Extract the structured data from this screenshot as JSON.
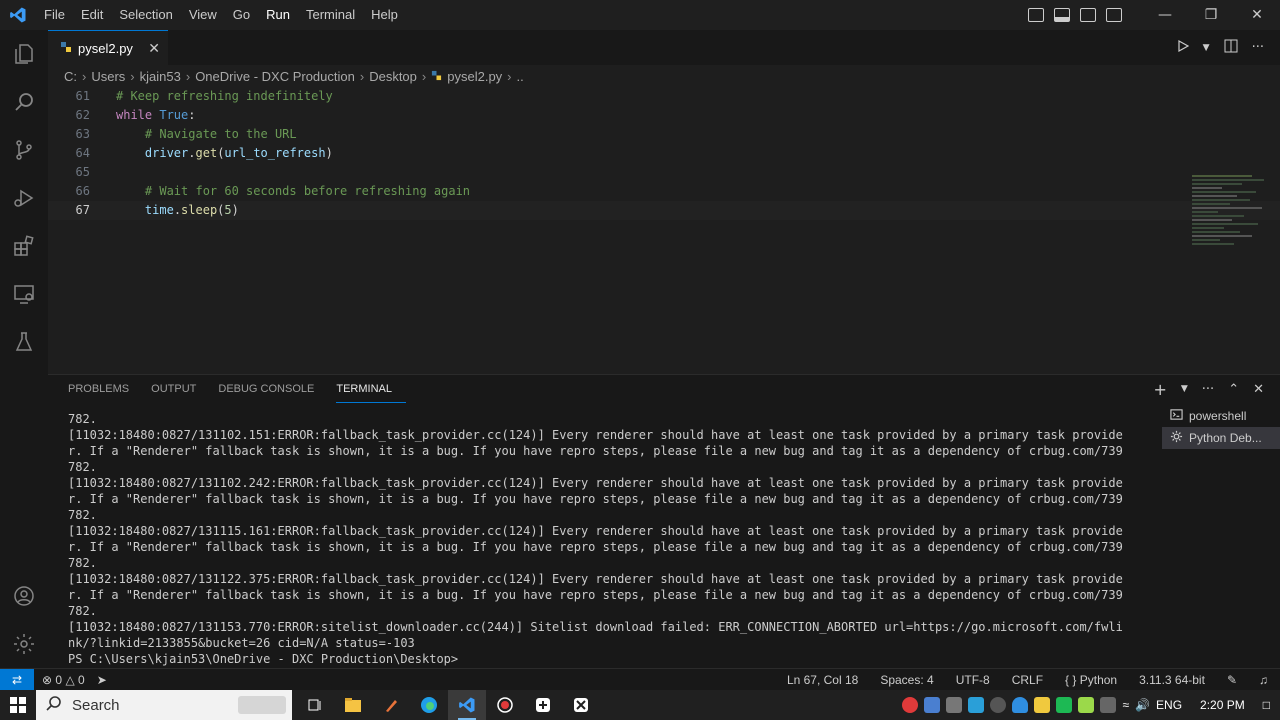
{
  "menu": [
    "File",
    "Edit",
    "Selection",
    "View",
    "Go",
    "Run",
    "Terminal",
    "Help"
  ],
  "menu_active_index": 5,
  "tab": {
    "filename": "pysel2.py",
    "close": "✕"
  },
  "breadcrumb": [
    "C:",
    "Users",
    "kjain53",
    "OneDrive - DXC Production",
    "Desktop",
    "pysel2.py",
    ".."
  ],
  "code": {
    "current_line": 67,
    "lines": [
      {
        "num": "61",
        "indent": "",
        "tokens": [
          {
            "t": "# Keep refreshing indefinitely",
            "c": "cmt"
          }
        ]
      },
      {
        "num": "62",
        "indent": "",
        "tokens": [
          {
            "t": "while",
            "c": "kw"
          },
          {
            "t": " ",
            "c": "plain"
          },
          {
            "t": "True",
            "c": "const"
          },
          {
            "t": ":",
            "c": "plain"
          }
        ]
      },
      {
        "num": "63",
        "indent": "    ",
        "tokens": [
          {
            "t": "# Navigate to the URL",
            "c": "cmt"
          }
        ]
      },
      {
        "num": "64",
        "indent": "    ",
        "tokens": [
          {
            "t": "driver",
            "c": "var"
          },
          {
            "t": ".",
            "c": "plain"
          },
          {
            "t": "get",
            "c": "fn"
          },
          {
            "t": "(",
            "c": "plain"
          },
          {
            "t": "url_to_refresh",
            "c": "var"
          },
          {
            "t": ")",
            "c": "plain"
          }
        ]
      },
      {
        "num": "65",
        "indent": "",
        "tokens": []
      },
      {
        "num": "66",
        "indent": "    ",
        "tokens": [
          {
            "t": "# Wait for 60 seconds before refreshing again",
            "c": "cmt"
          }
        ]
      },
      {
        "num": "67",
        "indent": "    ",
        "tokens": [
          {
            "t": "time",
            "c": "var"
          },
          {
            "t": ".",
            "c": "plain"
          },
          {
            "t": "sleep",
            "c": "fn"
          },
          {
            "t": "(",
            "c": "plain"
          },
          {
            "t": "5",
            "c": "num"
          },
          {
            "t": ")",
            "c": "plain"
          }
        ]
      }
    ]
  },
  "panel": {
    "tabs": [
      "PROBLEMS",
      "OUTPUT",
      "DEBUG CONSOLE",
      "TERMINAL"
    ],
    "active_tab_index": 3,
    "terminal_lines": [
      "782.",
      "[11032:18480:0827/131102.151:ERROR:fallback_task_provider.cc(124)] Every renderer should have at least one task provided by a primary task provide",
      "r. If a \"Renderer\" fallback task is shown, it is a bug. If you have repro steps, please file a new bug and tag it as a dependency of crbug.com/739",
      "782.",
      "[11032:18480:0827/131102.242:ERROR:fallback_task_provider.cc(124)] Every renderer should have at least one task provided by a primary task provide",
      "r. If a \"Renderer\" fallback task is shown, it is a bug. If you have repro steps, please file a new bug and tag it as a dependency of crbug.com/739",
      "782.",
      "[11032:18480:0827/131115.161:ERROR:fallback_task_provider.cc(124)] Every renderer should have at least one task provided by a primary task provide",
      "r. If a \"Renderer\" fallback task is shown, it is a bug. If you have repro steps, please file a new bug and tag it as a dependency of crbug.com/739",
      "782.",
      "[11032:18480:0827/131122.375:ERROR:fallback_task_provider.cc(124)] Every renderer should have at least one task provided by a primary task provide",
      "r. If a \"Renderer\" fallback task is shown, it is a bug. If you have repro steps, please file a new bug and tag it as a dependency of crbug.com/739",
      "782.",
      "[11032:18480:0827/131153.770:ERROR:sitelist_downloader.cc(244)] Sitelist download failed: ERR_CONNECTION_ABORTED url=https://go.microsoft.com/fwli",
      "nk/?linkid=2133855&bucket=26 cid=N/A status=-103",
      "PS C:\\Users\\kjain53\\OneDrive - DXC Production\\Desktop>"
    ],
    "terminals": [
      {
        "name": "powershell",
        "icon": "terminal-icon"
      },
      {
        "name": "Python Deb...",
        "icon": "gear-icon"
      }
    ],
    "active_terminal_index": 1
  },
  "statusbar": {
    "errors": "0",
    "warnings": "0",
    "cursor": "Ln 67, Col 18",
    "spaces": "Spaces: 4",
    "encoding": "UTF-8",
    "eol": "CRLF",
    "language": "Python",
    "interpreter": "3.11.3 64-bit"
  },
  "taskbar": {
    "search_label": "Search",
    "language": "ENG",
    "time": "2:20 PM"
  },
  "colors": {
    "accent": "#0078d4",
    "comment": "#6a9955",
    "keyword": "#c586c0"
  }
}
